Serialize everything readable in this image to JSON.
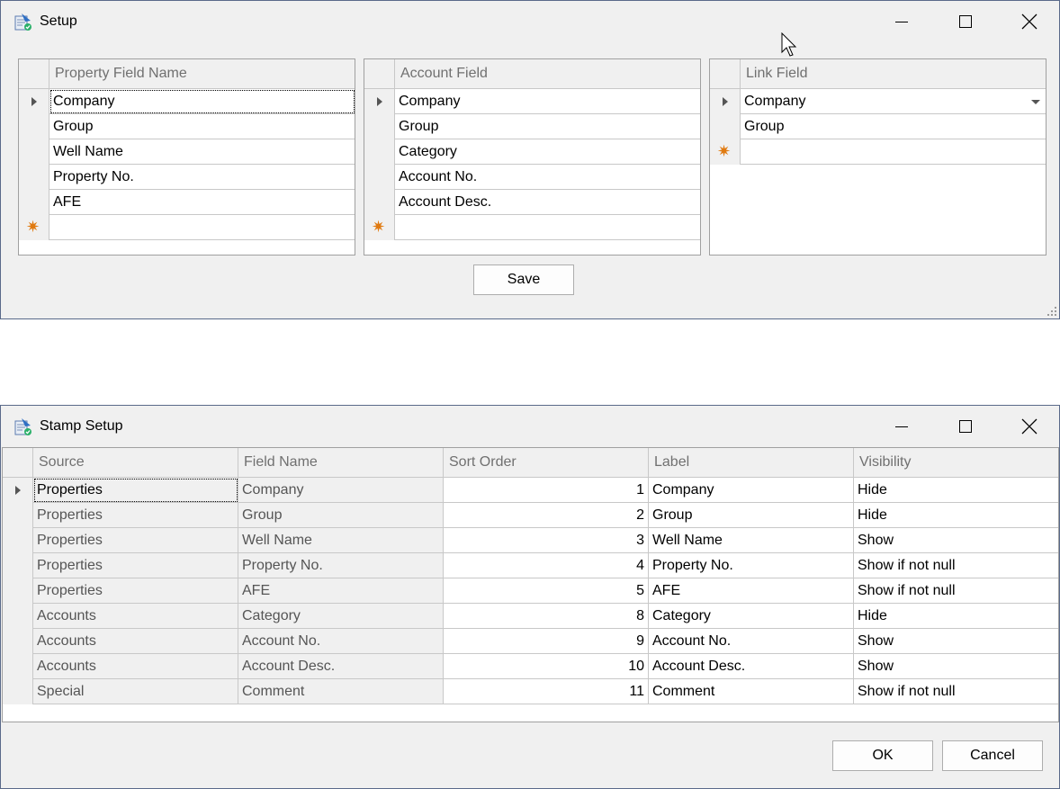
{
  "setup_window": {
    "title": "Setup",
    "property_grid": {
      "header": "Property Field Name",
      "rows": [
        "Company",
        "Group",
        "Well Name",
        "Property No.",
        "AFE"
      ]
    },
    "account_grid": {
      "header": "Account Field",
      "rows": [
        "Company",
        "Group",
        "Category",
        "Account No.",
        "Account Desc."
      ]
    },
    "link_grid": {
      "header": "Link Field",
      "rows": [
        "Company",
        "Group"
      ]
    },
    "save_label": "Save"
  },
  "stamp_window": {
    "title": "Stamp Setup",
    "columns": [
      "Source",
      "Field Name",
      "Sort Order",
      "Label",
      "Visibility"
    ],
    "rows": [
      {
        "source": "Properties",
        "field": "Company",
        "order": "1",
        "label": "Company",
        "visibility": "Hide"
      },
      {
        "source": "Properties",
        "field": "Group",
        "order": "2",
        "label": "Group",
        "visibility": "Hide"
      },
      {
        "source": "Properties",
        "field": "Well Name",
        "order": "3",
        "label": "Well Name",
        "visibility": "Show"
      },
      {
        "source": "Properties",
        "field": "Property No.",
        "order": "4",
        "label": "Property No.",
        "visibility": "Show if not null"
      },
      {
        "source": "Properties",
        "field": "AFE",
        "order": "5",
        "label": "AFE",
        "visibility": "Show if not null"
      },
      {
        "source": "Accounts",
        "field": "Category",
        "order": "8",
        "label": "Category",
        "visibility": "Hide"
      },
      {
        "source": "Accounts",
        "field": "Account No.",
        "order": "9",
        "label": "Account No.",
        "visibility": "Show"
      },
      {
        "source": "Accounts",
        "field": "Account Desc.",
        "order": "10",
        "label": "Account Desc.",
        "visibility": "Show"
      },
      {
        "source": "Special",
        "field": "Comment",
        "order": "11",
        "label": "Comment",
        "visibility": "Show if not null"
      }
    ],
    "ok_label": "OK",
    "cancel_label": "Cancel"
  },
  "icons": {
    "app": "app-logo-icon",
    "minimize": "minimize-icon",
    "maximize": "maximize-icon",
    "close": "close-icon",
    "row_pointer": "row-pointer-icon",
    "new_row": "new-row-star-icon",
    "dropdown": "dropdown-arrow-icon",
    "resize": "resize-grip-icon",
    "cursor": "mouse-cursor-icon"
  }
}
